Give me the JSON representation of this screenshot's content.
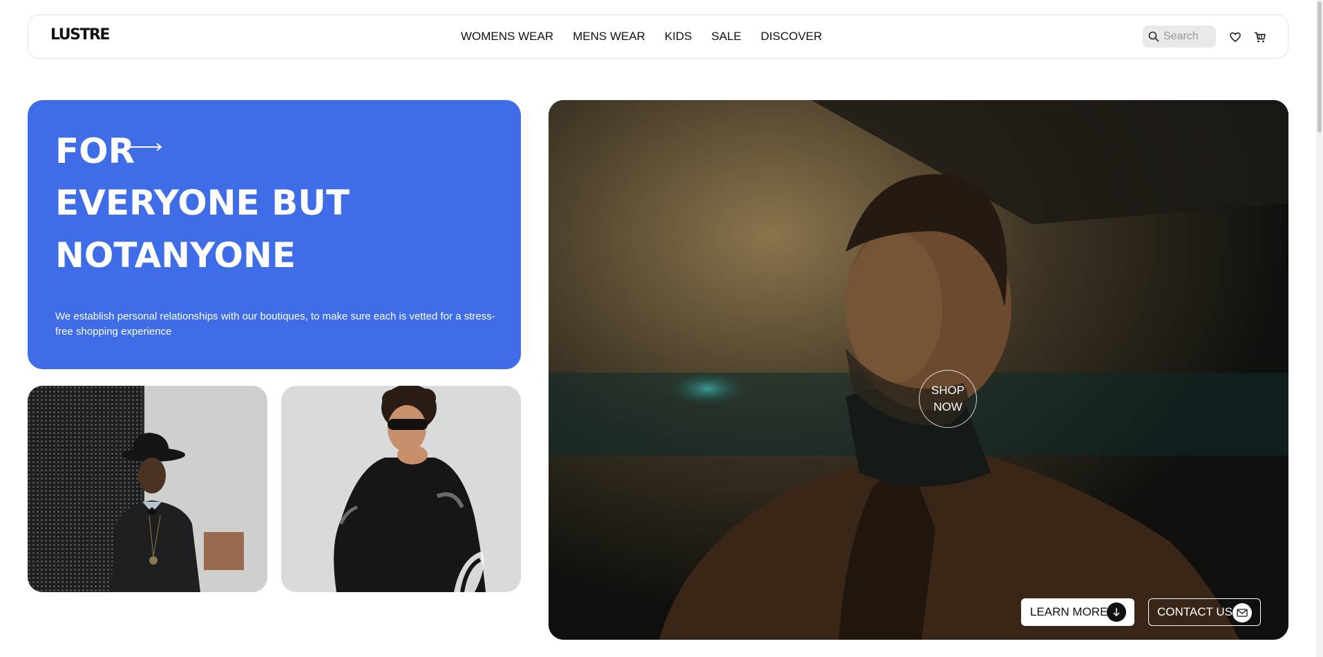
{
  "brand": {
    "logo": "LUSTRE"
  },
  "nav": {
    "items": [
      "WOMENS WEAR",
      "MENS WEAR",
      "KIDS",
      "SALE",
      "DISCOVER"
    ]
  },
  "search": {
    "placeholder": "Search",
    "value": ""
  },
  "hero": {
    "line1": "FOR",
    "line2": "EVERYONE BUT",
    "line3": "NOTANYONE",
    "description": "We establish personal relationships with our boutiques, to make sure each is vetted for a stress-free shopping experience",
    "accent_color": "#3f6de8"
  },
  "feature": {
    "shop_now_line1": "SHOP",
    "shop_now_line2": "NOW",
    "learn_more": "LEARN MORE",
    "contact_us": "CONTACT US"
  }
}
